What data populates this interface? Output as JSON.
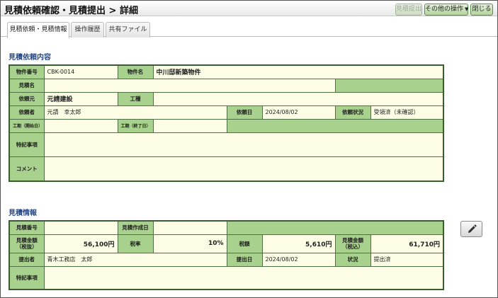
{
  "header": {
    "title": "見積依頼確認・見積提出 > 詳細",
    "buttons": {
      "submit_label": "見積提出",
      "other_ops_label": "その他の操作",
      "close_label": "閉じる"
    }
  },
  "tabs": [
    {
      "label": "見積依頼・見積情報",
      "active": true
    },
    {
      "label": "操作履歴",
      "active": false
    },
    {
      "label": "共有ファイル",
      "active": false
    }
  ],
  "request": {
    "section_title": "見積依頼内容",
    "labels": {
      "property_no": "物件番号",
      "property_name": "物件名",
      "estimate_name": "見積名",
      "client": "依頼元",
      "work_type": "工種",
      "requester": "依頼者",
      "request_date": "依頼日",
      "request_status": "依頼状況",
      "start_date": "工期（開始日）",
      "end_date": "工期（終了日）",
      "notes": "特記事項",
      "comment": "コメント"
    },
    "values": {
      "property_no": "CBK-0014",
      "property_name": "中川邸新築物件",
      "estimate_name": "",
      "client": "元請建設",
      "work_type": "",
      "requester": "元請　幸太郎",
      "request_date": "2024/08/02",
      "request_status": "受領済（未確認）",
      "start_date": "",
      "end_date": "",
      "notes": "",
      "comment": ""
    }
  },
  "estimate": {
    "section_title": "見積情報",
    "labels": {
      "estimate_no": "見積番号",
      "created_date": "見積作成日",
      "amount_excl_1": "見積金額",
      "amount_excl_2": "（税抜）",
      "tax_rate": "税率",
      "tax_amount": "税額",
      "amount_incl_1": "見積金額",
      "amount_incl_2": "（税込）",
      "submitter": "提出者",
      "submit_date": "提出日",
      "status": "状況",
      "notes": "特記事項"
    },
    "values": {
      "estimate_no": "",
      "created_date": "",
      "amount_excl": "56,100円",
      "tax_rate": "10%",
      "tax_amount": "5,610円",
      "amount_incl": "61,710円",
      "submitter": "青木工務店　太郎",
      "submit_date": "2024/08/02",
      "status": "提出済",
      "notes": ""
    }
  },
  "icons": {
    "edit": "pencil-icon",
    "dropdown": "caret-down-icon"
  },
  "colors": {
    "label_bg": "#a9d18e",
    "value_bg": "#fdfde6",
    "section_title": "#2a4a86",
    "table_border": "#3b5b32"
  }
}
